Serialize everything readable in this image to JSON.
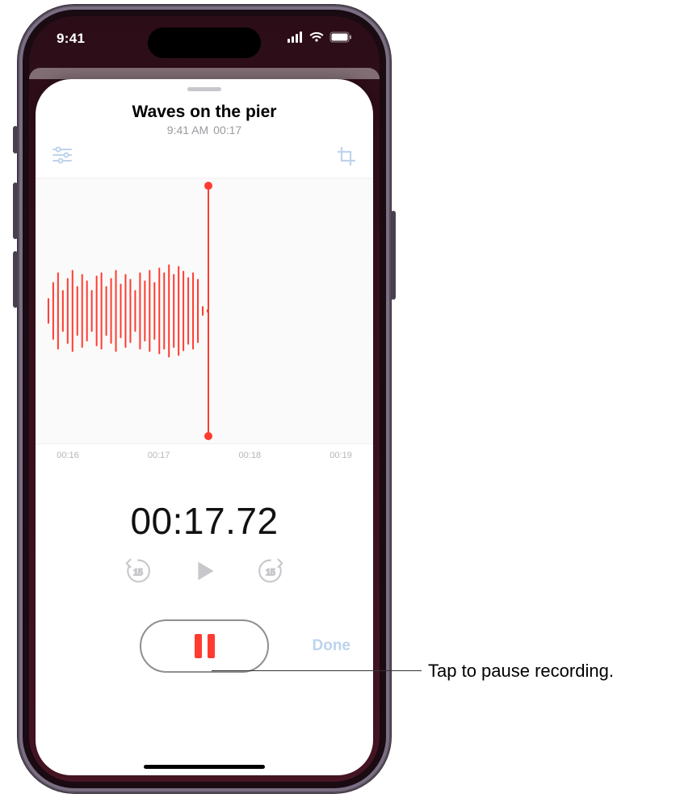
{
  "statusbar": {
    "time": "9:41"
  },
  "recording": {
    "title": "Waves on the pier",
    "time_label": "9:41 AM",
    "duration_label": "00:17",
    "elapsed_display": "00:17.72"
  },
  "timeline": {
    "ticks": [
      "00:16",
      "00:17",
      "00:18",
      "00:19"
    ]
  },
  "controls": {
    "skip_back_seconds": "15",
    "skip_fwd_seconds": "15",
    "done_label": "Done"
  },
  "callout": {
    "text": "Tap to pause recording."
  },
  "colors": {
    "accent_red": "#ff3b30",
    "disabled_blue": "#bcd3ec",
    "muted_gray": "#c7c7cc"
  }
}
